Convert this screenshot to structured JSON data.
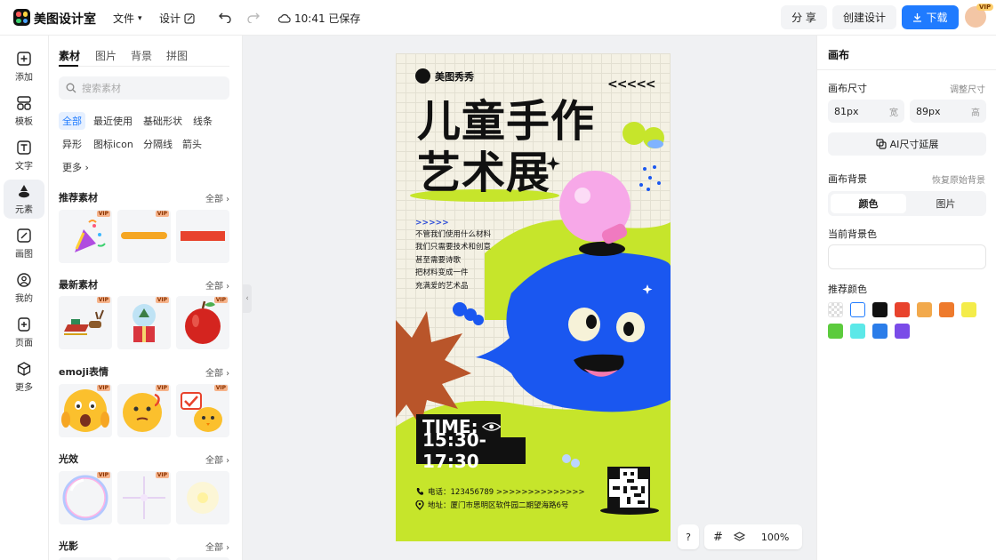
{
  "app": {
    "brand": "美图设计室"
  },
  "topbar": {
    "file_menu": "文件",
    "design_menu": "设计",
    "saved_status": "10:41 已保存",
    "share_label": "分 享",
    "create_label": "创建设计",
    "download_label": "下载",
    "avatar_badge": "VIP"
  },
  "leftnav": {
    "items": [
      {
        "label": "添加",
        "icon": "plus-square-icon"
      },
      {
        "label": "模板",
        "icon": "template-icon"
      },
      {
        "label": "文字",
        "icon": "text-icon"
      },
      {
        "label": "元素",
        "icon": "shapes-icon"
      },
      {
        "label": "画图",
        "icon": "pen-icon"
      },
      {
        "label": "我的",
        "icon": "user-icon"
      },
      {
        "label": "页面",
        "icon": "page-add-icon"
      },
      {
        "label": "更多",
        "icon": "cube-icon"
      }
    ],
    "active": "元素"
  },
  "panel": {
    "tabs": [
      "素材",
      "图片",
      "背景",
      "拼图"
    ],
    "search_placeholder": "搜索素材",
    "chips": [
      "全部",
      "最近使用",
      "基础形状",
      "线条",
      "异形",
      "图标icon",
      "分隔线",
      "箭头",
      "更多"
    ],
    "all_label": "全部",
    "vip_label": "VIP",
    "sections": [
      {
        "title": "推荐素材"
      },
      {
        "title": "最新素材"
      },
      {
        "title": "emoji表情"
      },
      {
        "title": "光效"
      },
      {
        "title": "光影"
      }
    ]
  },
  "poster": {
    "brand": "美图秀秀",
    "arrows": "<<<<<",
    "title_line1": "儿童手作",
    "title_line2": "艺术展",
    "small_arrows": ">>>>>",
    "lines": [
      "不管我们使用什么材料",
      "我们只需要技术和创意",
      "甚至需要诗歌",
      "把材料变成一件",
      "充满爱的艺术品"
    ],
    "time_label": "TIME:",
    "time_value": "15:30-17:30",
    "phone": "电话：123456789 >>>>>>>>>>>>>>",
    "address": "地址：厦门市思明区软件园二期望海路6号"
  },
  "rightpanel": {
    "title": "画布",
    "size_label": "画布尺寸",
    "size_link": "调整尺寸",
    "width_value": "81px",
    "width_unit": "宽",
    "height_value": "89px",
    "height_unit": "高",
    "ai_button": "AI尺寸延展",
    "bg_label": "画布背景",
    "bg_link": "恢复原始背景",
    "seg_color": "颜色",
    "seg_image": "图片",
    "current_bg_label": "当前背景色",
    "recommend_label": "推荐颜色",
    "swatches": [
      "transparent",
      "#ffffff",
      "#111111",
      "#e8432d",
      "#f2a94c",
      "#ee7a2c",
      "#f4ec4a",
      "#5ccb3d",
      "#5ce8e8",
      "#2b7de9",
      "#7a4ce8"
    ]
  },
  "zoom": {
    "help": "?",
    "value": "100%"
  }
}
